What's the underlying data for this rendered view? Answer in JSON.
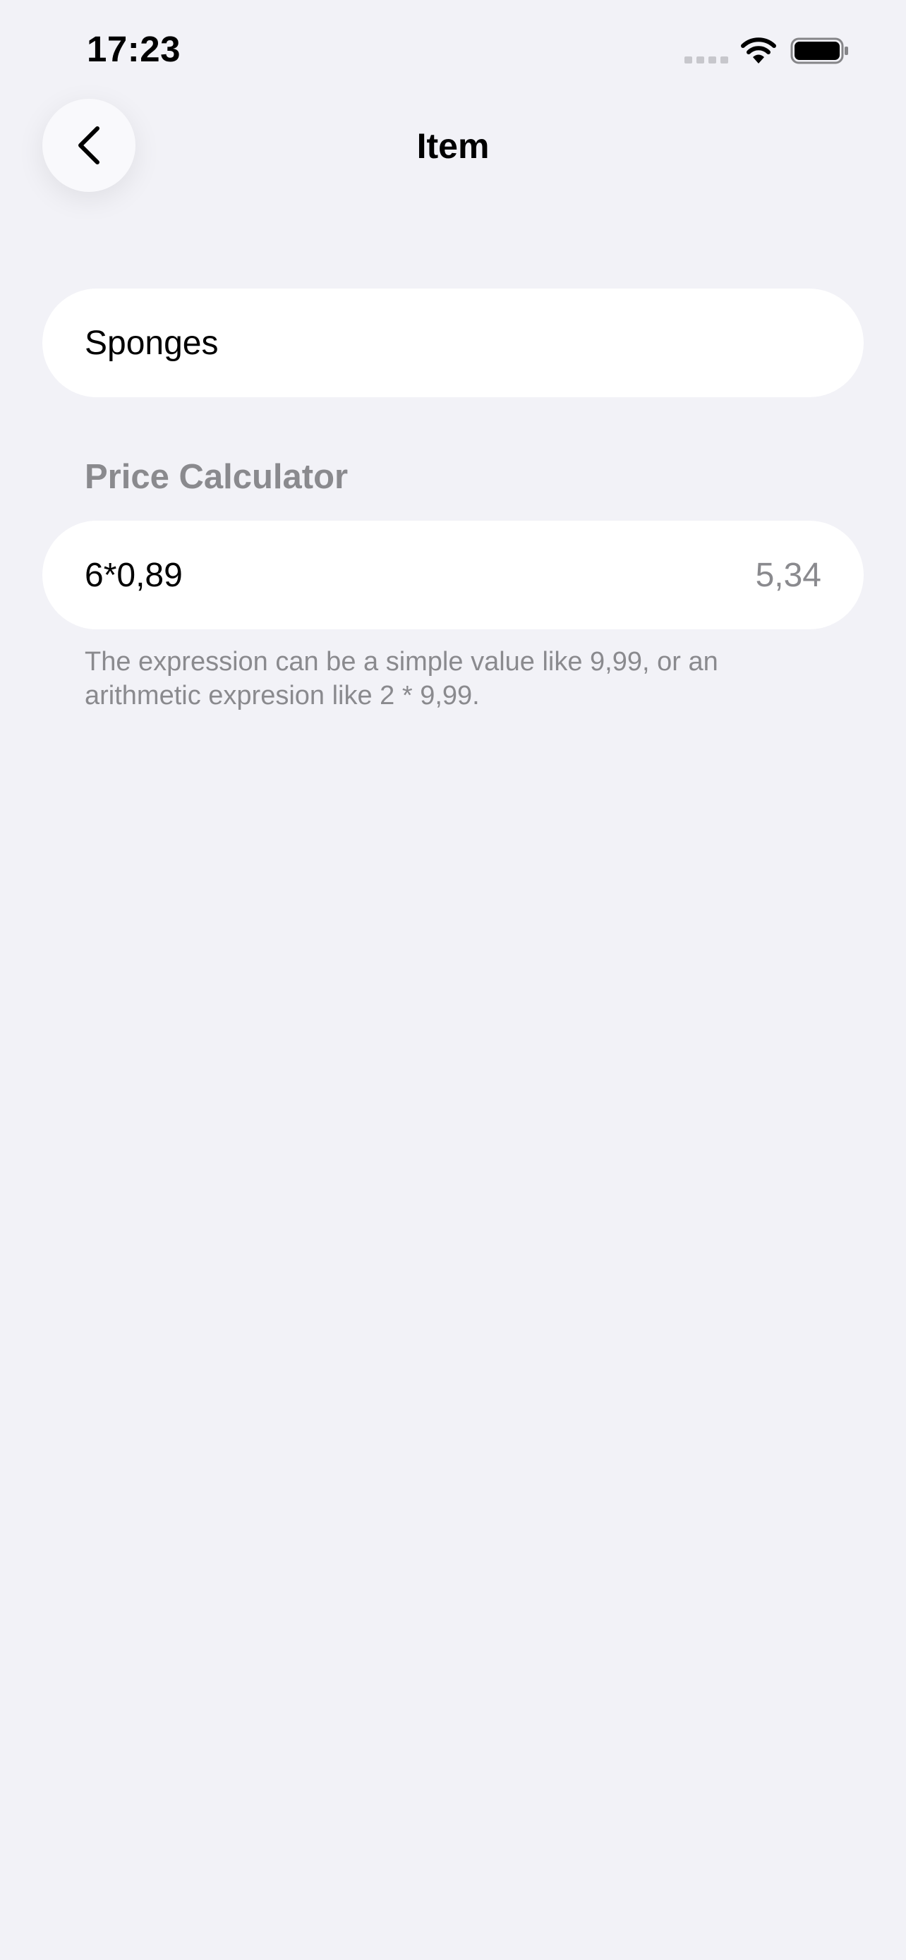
{
  "status_bar": {
    "time": "17:23"
  },
  "nav": {
    "title": "Item",
    "back_icon": "chevron-left-icon"
  },
  "item": {
    "name": "Sponges"
  },
  "price_calculator": {
    "header": "Price Calculator",
    "expression": "6*0,89",
    "result": "5,34",
    "note": "The expression can be a simple value like 9,99, or an arithmetic expresion like 2 * 9,99."
  },
  "colors": {
    "background": "#f2f2f7",
    "field_background": "#ffffff",
    "secondary_text": "#8a8a8e"
  }
}
